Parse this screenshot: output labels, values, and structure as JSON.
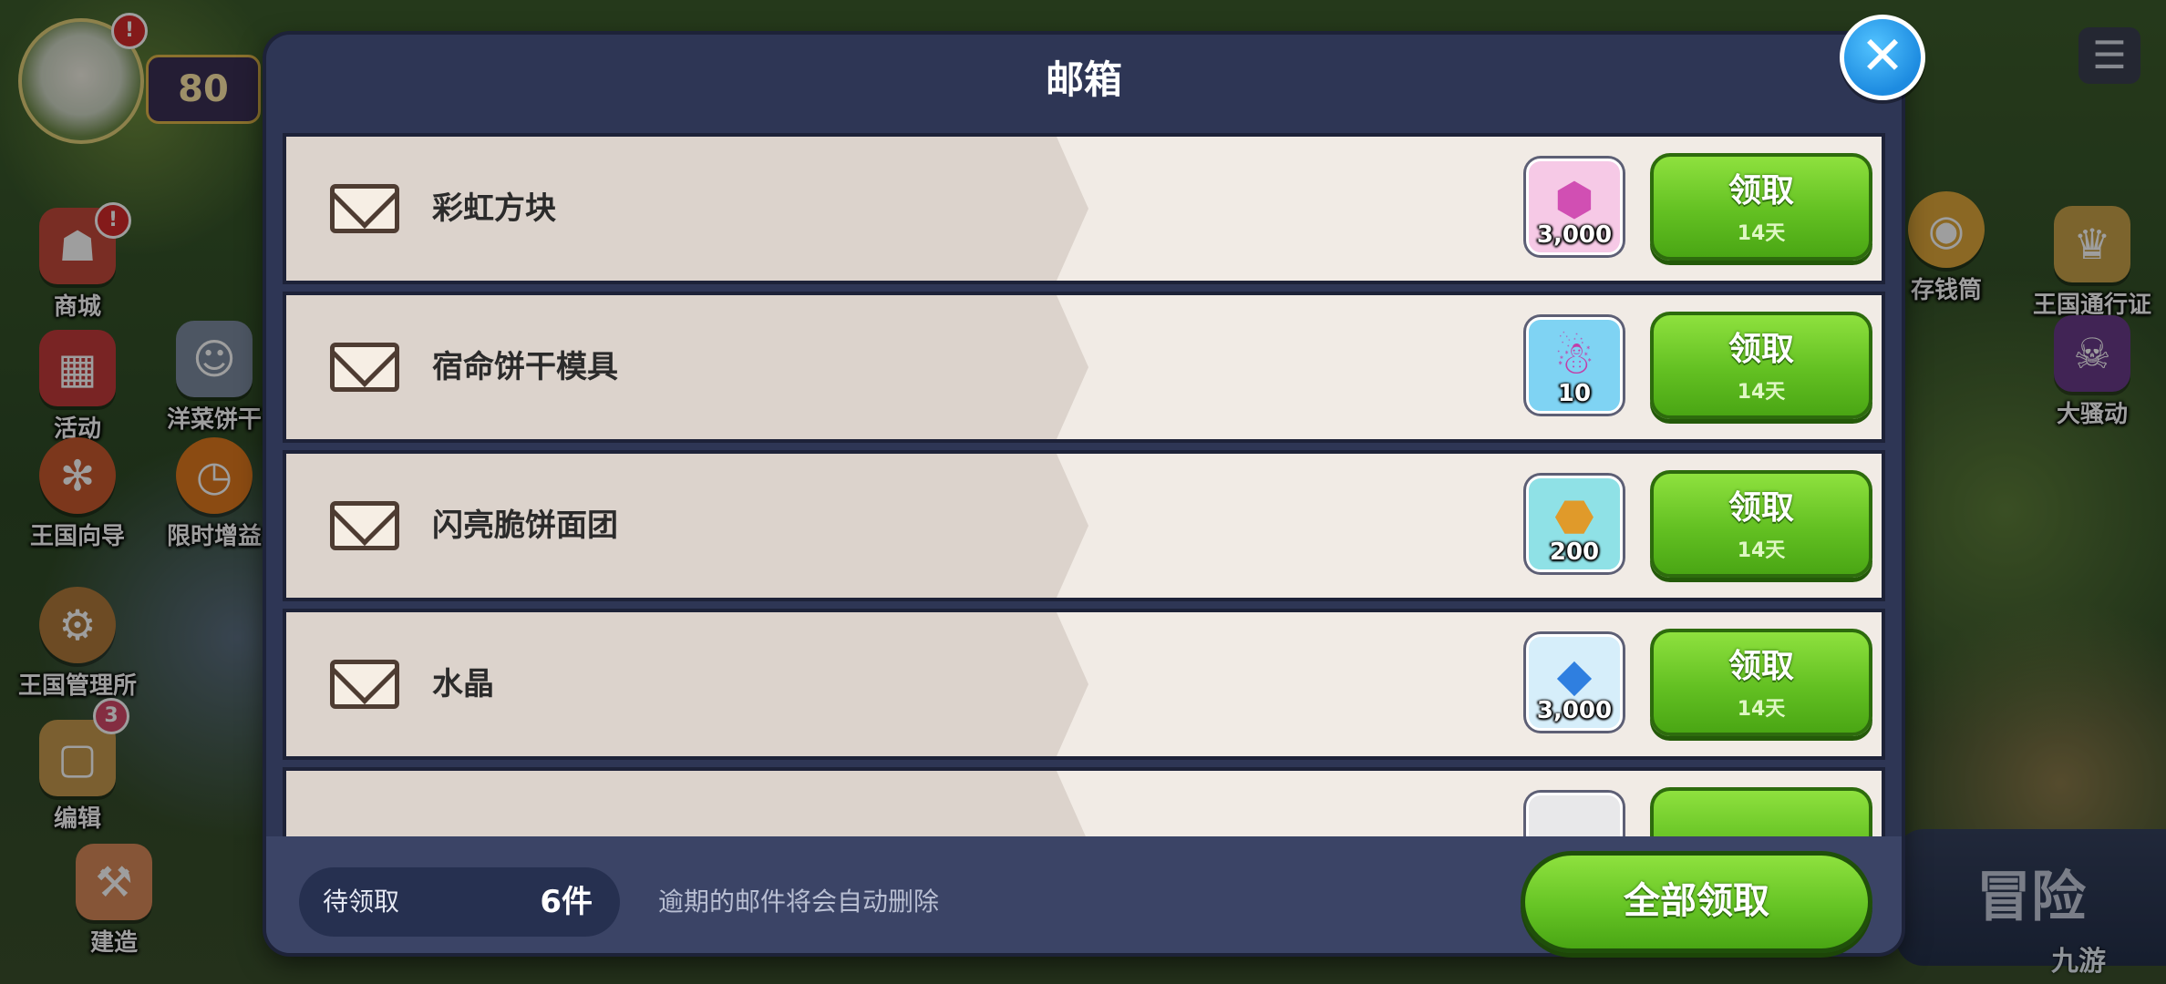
{
  "dialog": {
    "title": "邮箱",
    "close_icon": "close-icon"
  },
  "mails": [
    {
      "name": "彩虹方块",
      "reward_icon": "rainbow-cube-icon",
      "reward_qty": "3,000",
      "reward_bg": "#f6c9e6",
      "claim_label": "领取",
      "duration": "14天"
    },
    {
      "name": "宿命饼干模具",
      "reward_icon": "cookie-cutter-icon",
      "reward_qty": "10",
      "reward_bg": "#7fd3f3",
      "claim_label": "领取",
      "duration": "14天"
    },
    {
      "name": "闪亮脆饼面团",
      "reward_icon": "dough-icon",
      "reward_qty": "200",
      "reward_bg": "#8fe1e6",
      "claim_label": "领取",
      "duration": "14天"
    },
    {
      "name": "水晶",
      "reward_icon": "crystal-icon",
      "reward_qty": "3,000",
      "reward_bg": "#d6eefa",
      "claim_label": "领取",
      "duration": "14天"
    }
  ],
  "footer": {
    "pending_label": "待领取",
    "pending_count": "6件",
    "expire_note": "逾期的邮件将会自动删除",
    "claim_all_label": "全部领取"
  },
  "background": {
    "level": "80",
    "left_menu": [
      {
        "label": "商城",
        "icon": "shop-icon"
      },
      {
        "label": "活动",
        "icon": "gift-icon"
      },
      {
        "label": "洋菜饼干",
        "icon": "cookie-icon"
      },
      {
        "label": "王国向导",
        "icon": "compass-icon"
      },
      {
        "label": "限时增益",
        "icon": "boost-icon"
      },
      {
        "label": "王国管理所",
        "icon": "manage-icon"
      },
      {
        "label": "编辑",
        "icon": "edit-icon"
      },
      {
        "label": "建造",
        "icon": "build-icon"
      }
    ],
    "right_menu": [
      {
        "label": "存钱筒",
        "icon": "piggy-bank-icon"
      },
      {
        "label": "王国通行证",
        "icon": "pass-icon"
      },
      {
        "label": "大骚动",
        "icon": "riot-icon"
      }
    ],
    "edit_badge": "3",
    "adventure_label": "冒险",
    "watermark": "九游"
  },
  "colors": {
    "dialog_bg": "#2e3655",
    "row_bg": "#f1ebe5",
    "claim_green": "#63c022",
    "close_blue": "#1d8be0"
  }
}
